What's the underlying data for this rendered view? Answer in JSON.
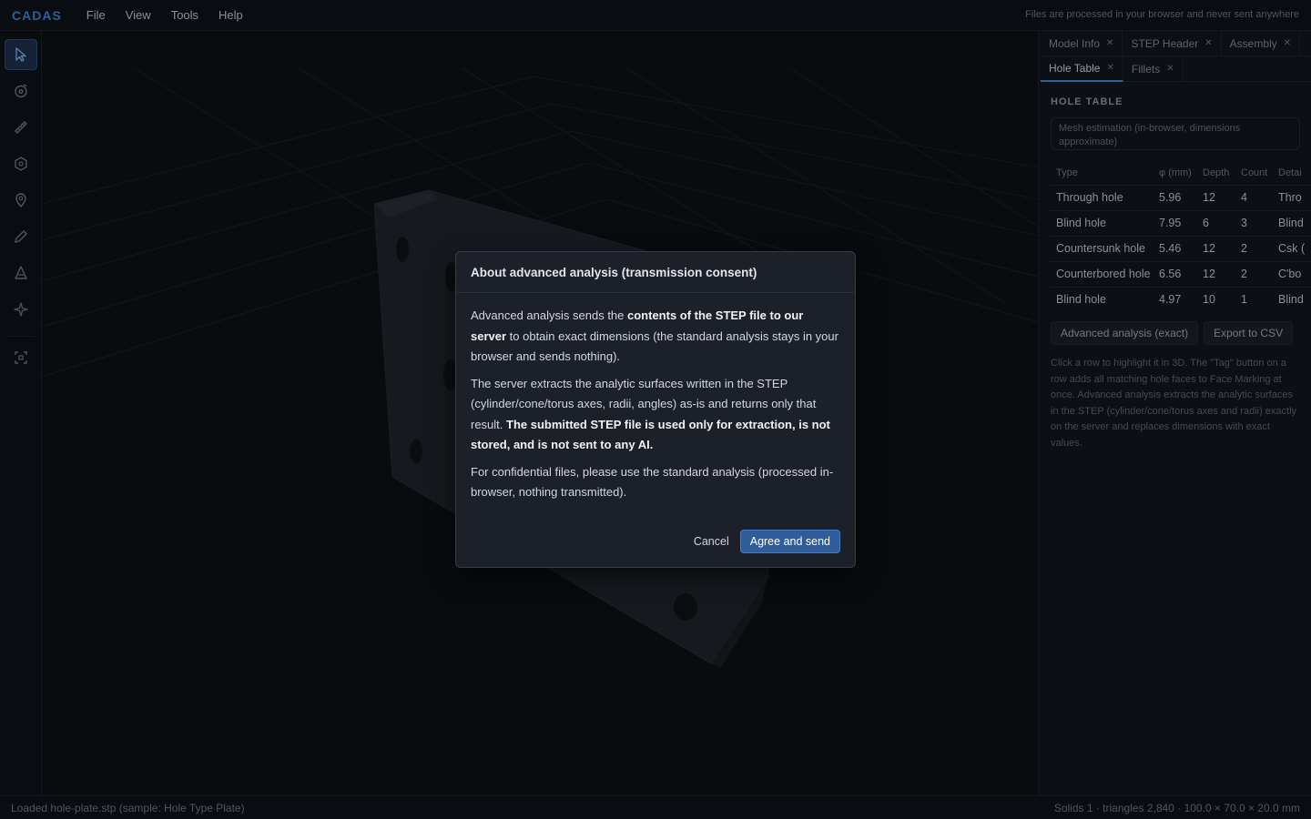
{
  "app": {
    "brand": "CADAS",
    "privacy_notice": "Files are processed in your browser and never sent anywhere"
  },
  "menu": [
    "File",
    "View",
    "Tools",
    "Help"
  ],
  "toolbar": [
    {
      "icon": "cursor-icon"
    },
    {
      "icon": "orbit-icon"
    },
    {
      "icon": "ruler-icon"
    },
    {
      "icon": "cube-icon"
    },
    {
      "icon": "pin-icon"
    },
    {
      "icon": "pencil-icon"
    },
    {
      "icon": "cone-icon"
    },
    {
      "icon": "sparkle-icon"
    },
    {
      "icon": "frame-icon"
    }
  ],
  "panel": {
    "tabs_row1": [
      "Model Info",
      "STEP Header",
      "Assembly"
    ],
    "tabs_row2": [
      "Hole Table",
      "Fillets"
    ],
    "active_tab": "Hole Table",
    "heading": "HOLE TABLE",
    "estimate_note": "Mesh estimation (in-browser, dimensions approximate)",
    "columns": [
      "Type",
      "φ (mm)",
      "Depth",
      "Count",
      "Detai"
    ],
    "rows": [
      [
        "Through hole",
        "5.96",
        "12",
        "4",
        "Thro"
      ],
      [
        "Blind hole",
        "7.95",
        "6",
        "3",
        "Blind"
      ],
      [
        "Countersunk hole",
        "5.46",
        "12",
        "2",
        "Csk ("
      ],
      [
        "Counterbored hole",
        "6.56",
        "12",
        "2",
        "C'bo"
      ],
      [
        "Blind hole",
        "4.97",
        "10",
        "1",
        "Blind"
      ]
    ],
    "advanced_button": "Advanced analysis (exact)",
    "export_button": "Export to CSV",
    "help_text": "Click a row to highlight it in 3D. The \"Tag\" button on a row adds all matching hole faces to Face Marking at once. Advanced analysis extracts the analytic surfaces in the STEP (cylinder/cone/torus axes and radii) exactly on the server and replaces dimensions with exact values."
  },
  "status": {
    "left": "Loaded hole-plate.stp (sample: Hole Type Plate)",
    "right": "Solids 1 · triangles 2,840 · 100.0 × 70.0 × 20.0 mm"
  },
  "modal": {
    "title": "About advanced analysis (transmission consent)",
    "p1_a": "Advanced analysis sends the ",
    "p1_bold": "contents of the STEP file to our server",
    "p1_b": " to obtain exact dimensions (the standard analysis stays in your browser and sends nothing).",
    "p2_a": "The server extracts the analytic surfaces written in the STEP (cylinder/cone/torus axes, radii, angles) as-is and returns only that result. ",
    "p2_bold": "The submitted STEP file is used only for extraction, is not stored, and is not sent to any AI.",
    "p3": "For confidential files, please use the standard analysis (processed in-browser, nothing transmitted).",
    "cancel": "Cancel",
    "agree": "Agree and send"
  },
  "colors": {
    "accent": "#3f7fd0",
    "primary_button": "#2f5c9a",
    "background": "#0e1117"
  }
}
